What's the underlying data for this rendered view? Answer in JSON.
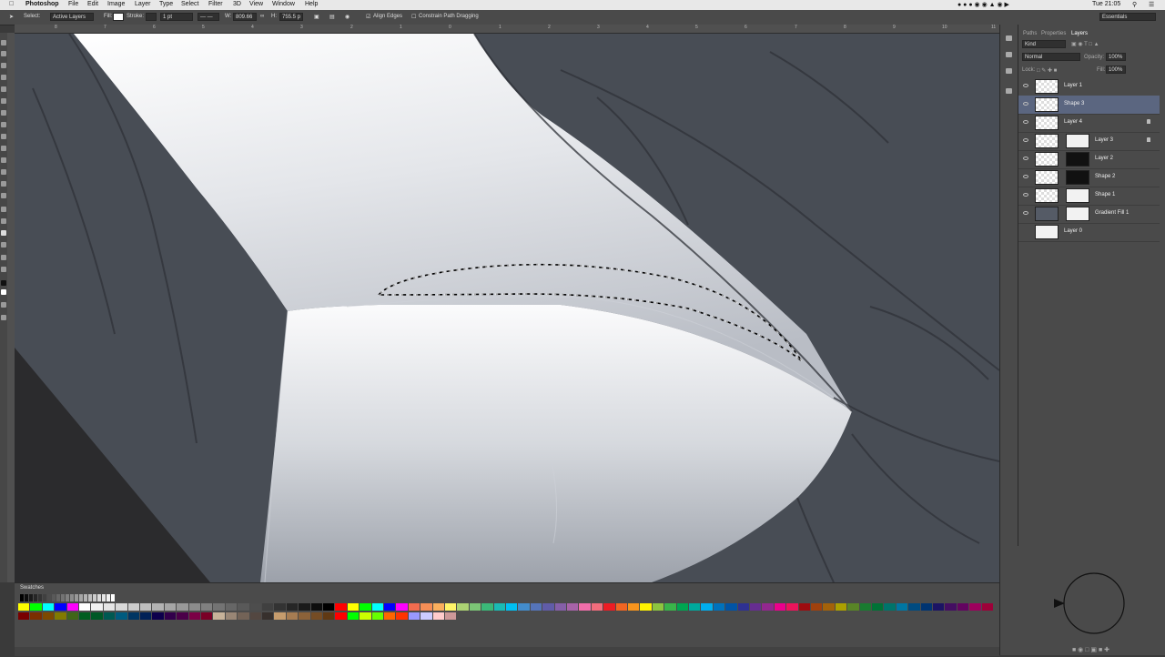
{
  "menubar": {
    "app": "Photoshop",
    "items": [
      "File",
      "Edit",
      "Image",
      "Layer",
      "Type",
      "Select",
      "Filter",
      "3D",
      "View",
      "Window",
      "Help"
    ],
    "clock": "Tue 21:05"
  },
  "options": {
    "select_label": "Select:",
    "select_value": "Active Layers",
    "fill_label": "Fill:",
    "stroke_label": "Stroke:",
    "stroke_width": "1 pt",
    "w_label": "W:",
    "w_value": "809.66",
    "h_label": "H:",
    "h_value": "755.5 p",
    "align_edges": "Align Edges",
    "constrain": "Constrain Path Dragging",
    "workspace": "Essentials"
  },
  "ruler": [
    "8",
    "7",
    "6",
    "5",
    "4",
    "3",
    "2",
    "1",
    "0",
    "1",
    "2",
    "3",
    "4",
    "5",
    "6",
    "7",
    "8",
    "9",
    "10",
    "11"
  ],
  "panel": {
    "tabs": [
      "Paths",
      "Properties",
      "Layers"
    ],
    "filter_kind": "Kind",
    "blend_mode": "Normal",
    "opacity_label": "Opacity:",
    "opacity_value": "100%",
    "lock_label": "Lock:",
    "fill_label": "Fill:",
    "fill_value": "100%",
    "layers": [
      {
        "name": "Layer 1",
        "selected": false,
        "mask": false,
        "locked": false
      },
      {
        "name": "Shape 3",
        "selected": true,
        "mask": false,
        "locked": false
      },
      {
        "name": "Layer 4",
        "selected": false,
        "mask": false,
        "locked": true
      },
      {
        "name": "Layer 3",
        "selected": false,
        "mask": true,
        "locked": true
      },
      {
        "name": "Layer 2",
        "selected": false,
        "mask": true,
        "locked": false
      },
      {
        "name": "Shape 2",
        "selected": false,
        "mask": true,
        "locked": false
      },
      {
        "name": "Shape 1",
        "selected": false,
        "mask": true,
        "locked": false
      },
      {
        "name": "Gradient Fill 1",
        "selected": false,
        "mask": true,
        "locked": false
      },
      {
        "name": "Layer 0",
        "selected": false,
        "mask": false,
        "locked": false
      }
    ]
  },
  "swatches": {
    "title": "Swatches",
    "row1": [
      "#ffff00",
      "#00ff00",
      "#00ffff",
      "#0000ff",
      "#ff00ff",
      "#ffffff",
      "#f2f2f2",
      "#e6e6e6",
      "#d9d9d9",
      "#cccccc",
      "#bfbfbf",
      "#b3b3b3",
      "#a6a6a6",
      "#999999",
      "#8c8c8c",
      "#808080",
      "#737373",
      "#666666",
      "#595959",
      "#4d4d4d",
      "#404040",
      "#333333",
      "#262626",
      "#1a1a1a",
      "#0d0d0d",
      "#000000",
      "#ff0000",
      "#ffff00",
      "#00ff00",
      "#00ffff",
      "#0000ff",
      "#ff00ff",
      "#f26c4f",
      "#f68e56",
      "#fbaf5d",
      "#fff568",
      "#acd373",
      "#7cc576",
      "#3bb878",
      "#1abbb4",
      "#00bff3",
      "#438ccb",
      "#5574b9",
      "#605ca8",
      "#855fa8",
      "#a763a8",
      "#f06eaa",
      "#f26d7d",
      "#ed1c24",
      "#f26522",
      "#f7941d",
      "#fff200",
      "#8dc63f",
      "#39b54a",
      "#00a651",
      "#00a99d",
      "#00aeef",
      "#0072bc",
      "#0054a6",
      "#2e3192",
      "#662d91",
      "#92278f",
      "#ec008c",
      "#ed145b",
      "#9e0b0f",
      "#a0410d",
      "#a3620a",
      "#aba000",
      "#598527",
      "#197b30",
      "#007236",
      "#00746b",
      "#0076a3",
      "#004b80",
      "#003471",
      "#1b1464",
      "#440e62",
      "#630460",
      "#9e005d",
      "#9e0039"
    ],
    "row2": [
      "#790000",
      "#7b2e00",
      "#7d4900",
      "#827b00",
      "#406618",
      "#005e20",
      "#005826",
      "#005952",
      "#005b7f",
      "#003663",
      "#002157",
      "#0d004c",
      "#32004b",
      "#4b0049",
      "#7b0046",
      "#7a0026",
      "#c7b299",
      "#998675",
      "#736357",
      "#534741",
      "#37302d",
      "#c69c6d",
      "#a67c52",
      "#8c6239",
      "#754c24",
      "#603913",
      "#ff0000",
      "#00ff00",
      "#ccff00",
      "#66ff00",
      "#ff6600",
      "#ff3300",
      "#9999ff",
      "#ccccff",
      "#ffcccc",
      "#cc9999"
    ]
  },
  "colors": {
    "canvas_bg": "#484d55",
    "panel_bg": "#4a4a4a",
    "selected_layer": "#5b6680"
  }
}
